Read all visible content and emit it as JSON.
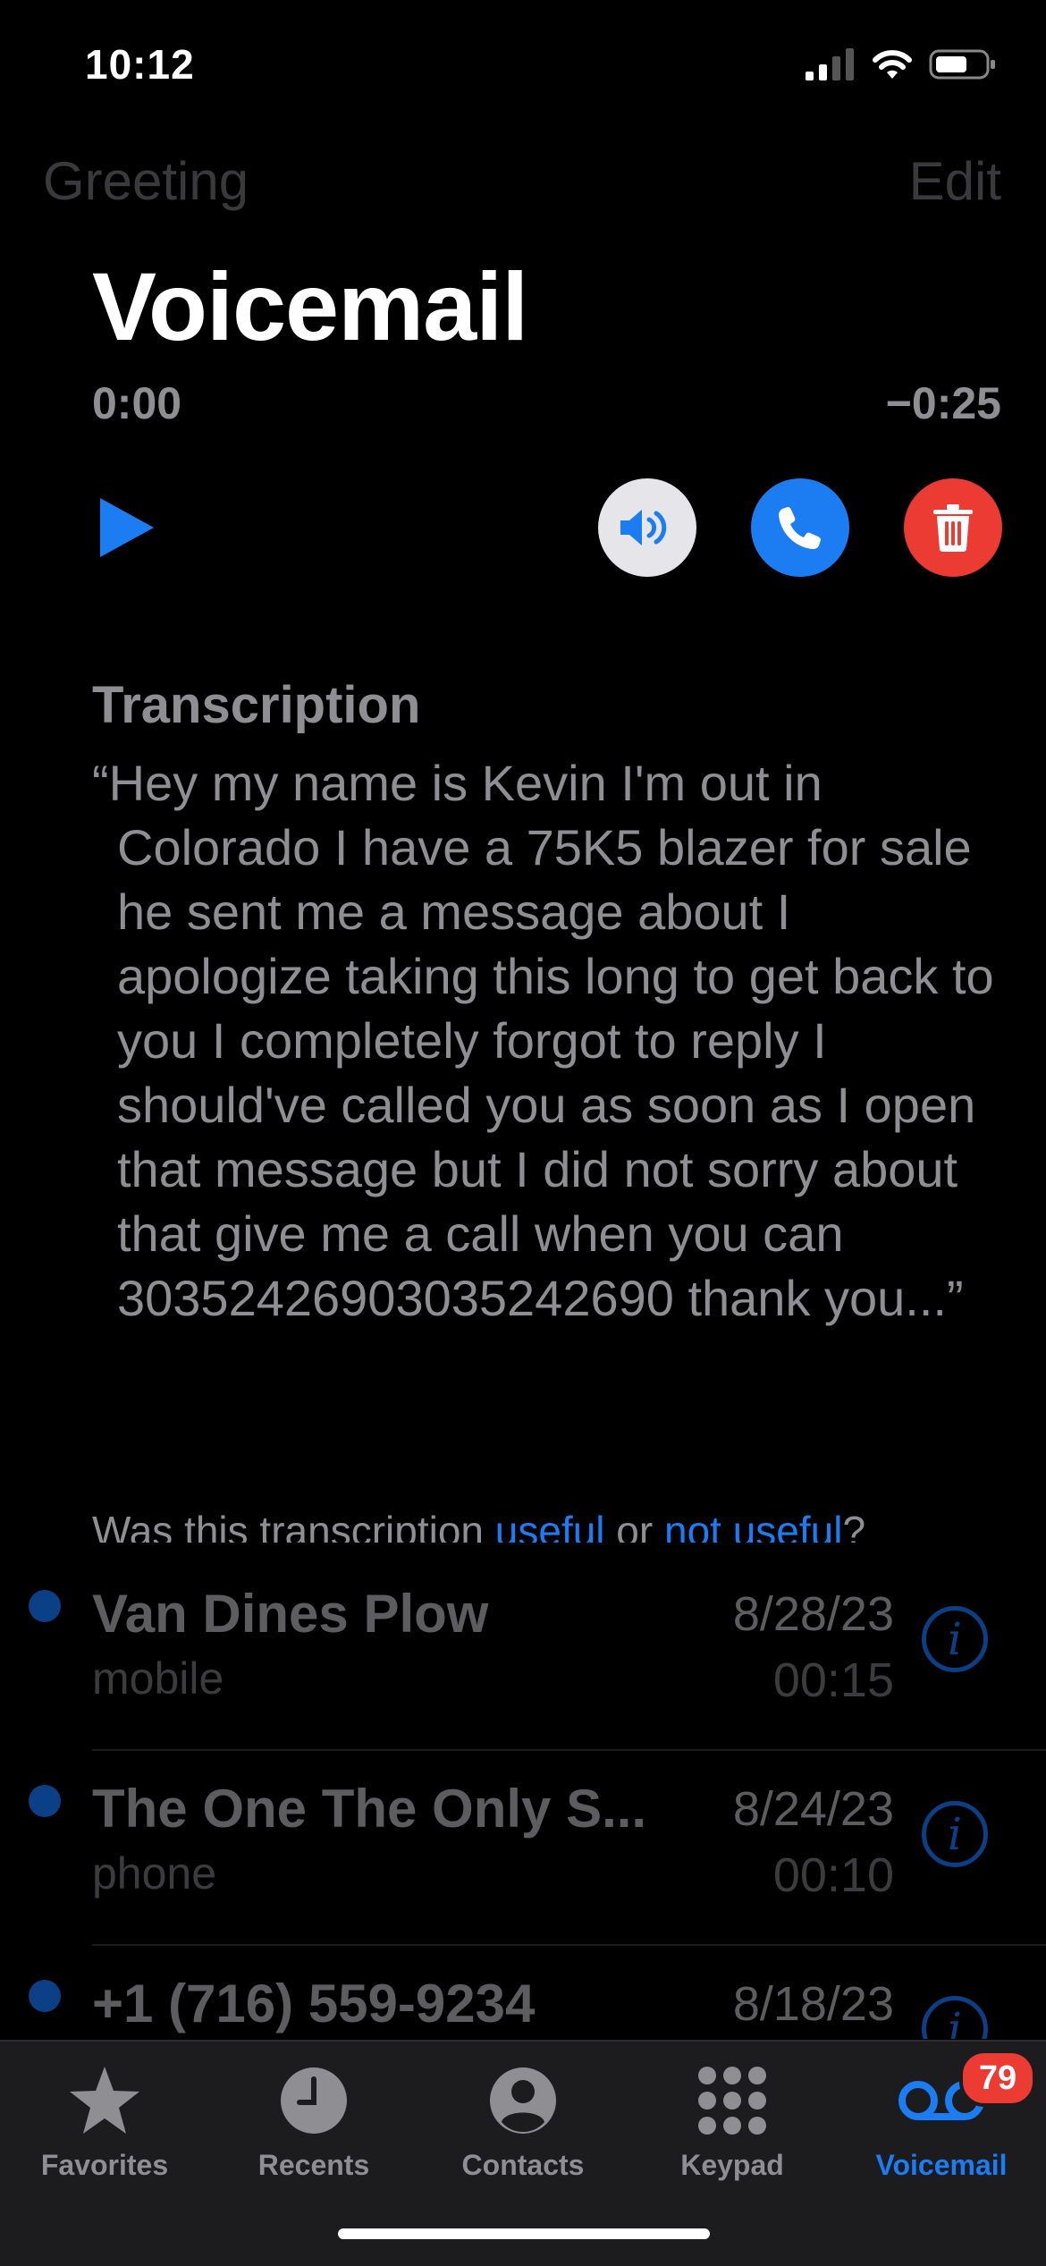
{
  "status": {
    "time": "10:12"
  },
  "nav": {
    "left": "Greeting",
    "right": "Edit"
  },
  "title": "Voicemail",
  "player": {
    "elapsed": "0:00",
    "remaining": "−0:25"
  },
  "transcription": {
    "heading": "Transcription",
    "text": "“Hey my name is Kevin I'm out in Colorado I have a 75K5 blazer for sale he sent me a message about I apologize taking this long to get back to you I completely forgot to reply I should've called you as soon as I open that message but I did not sorry about that give me a call when you can 30352426903035242690 thank you...”",
    "feedback_prefix": "Was this transcription ",
    "useful": "useful",
    "or": " or ",
    "not_useful": "not useful",
    "suffix": "?"
  },
  "voicemails": [
    {
      "name": "Van Dines Plow",
      "label": "mobile",
      "date": "8/28/23",
      "duration": "00:15"
    },
    {
      "name": "The One The Only S...",
      "label": "phone",
      "date": "8/24/23",
      "duration": "00:10"
    },
    {
      "name": "+1 (716) 559-9234",
      "label": "",
      "date": "8/18/23",
      "duration": ""
    }
  ],
  "tabs": [
    {
      "label": "Favorites",
      "icon": "star-icon"
    },
    {
      "label": "Recents",
      "icon": "clock-icon"
    },
    {
      "label": "Contacts",
      "icon": "person-circle-icon"
    },
    {
      "label": "Keypad",
      "icon": "keypad-icon"
    },
    {
      "label": "Voicemail",
      "icon": "voicemail-icon"
    }
  ],
  "badge": "79",
  "colors": {
    "accent": "#1c7cf2",
    "delete": "#eb3b32",
    "unread_dot": "#0b3f86"
  }
}
